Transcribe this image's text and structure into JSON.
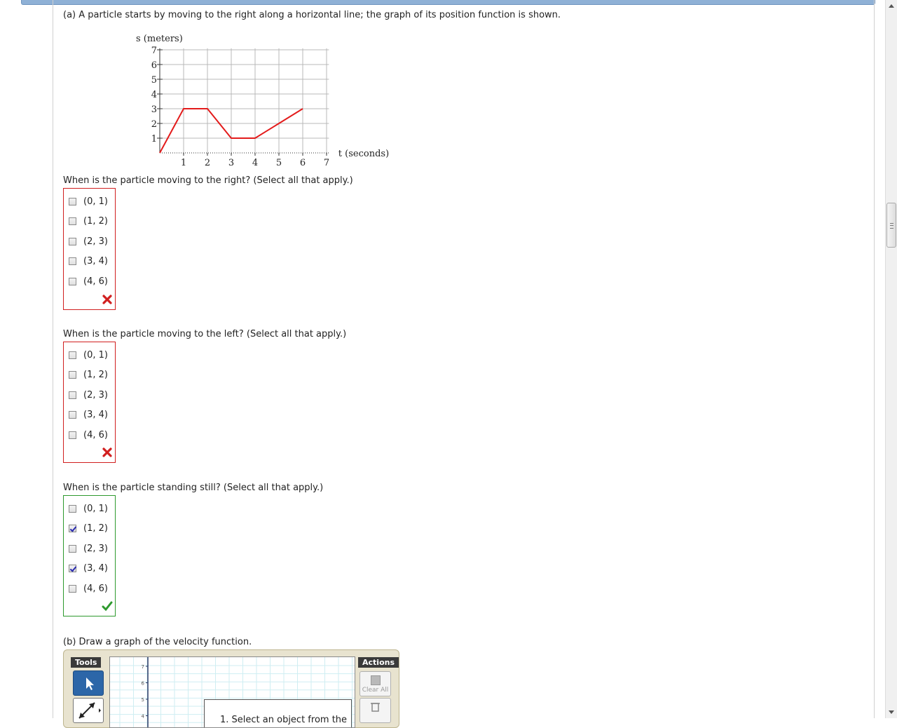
{
  "part_a": {
    "prompt": "(a) A particle starts by moving to the right along a horizontal line; the graph of its position function is shown."
  },
  "chart_data": {
    "type": "line",
    "ylabel": "s (meters)",
    "xlabel": "t (seconds)",
    "x_ticks": [
      "1",
      "2",
      "3",
      "4",
      "5",
      "6",
      "7"
    ],
    "y_ticks": [
      "1",
      "2",
      "3",
      "4",
      "5",
      "6",
      "7"
    ],
    "xlim": [
      0,
      7
    ],
    "ylim": [
      0,
      7
    ],
    "grid": true,
    "series": [
      {
        "color": "#e31b1b",
        "x": [
          0,
          1,
          2,
          3,
          4,
          5,
          6
        ],
        "y": [
          0,
          3,
          3,
          1,
          1,
          2,
          3
        ]
      }
    ]
  },
  "questions": [
    {
      "prompt": "When is the particle moving to the right? (Select all that apply.)",
      "status": "incorrect",
      "options": [
        {
          "label": "(0, 1)",
          "checked": false
        },
        {
          "label": "(1, 2)",
          "checked": false
        },
        {
          "label": "(2, 3)",
          "checked": false
        },
        {
          "label": "(3, 4)",
          "checked": false
        },
        {
          "label": "(4, 6)",
          "checked": false
        }
      ]
    },
    {
      "prompt": "When is the particle moving to the left? (Select all that apply.)",
      "status": "incorrect",
      "options": [
        {
          "label": "(0, 1)",
          "checked": false
        },
        {
          "label": "(1, 2)",
          "checked": false
        },
        {
          "label": "(2, 3)",
          "checked": false
        },
        {
          "label": "(3, 4)",
          "checked": false
        },
        {
          "label": "(4, 6)",
          "checked": false
        }
      ]
    },
    {
      "prompt": "When is the particle standing still? (Select all that apply.)",
      "status": "correct",
      "options": [
        {
          "label": "(0, 1)",
          "checked": false
        },
        {
          "label": "(1, 2)",
          "checked": true
        },
        {
          "label": "(2, 3)",
          "checked": false
        },
        {
          "label": "(3, 4)",
          "checked": true
        },
        {
          "label": "(4, 6)",
          "checked": false
        }
      ]
    }
  ],
  "part_b": {
    "prompt": "(b) Draw a graph of the velocity function.",
    "tools_label": "Tools",
    "actions_label": "Actions",
    "clear_all_label": "Clear All",
    "axis_ticks": [
      "7",
      "6",
      "5",
      "4"
    ],
    "tooltip_text": "1. Select an object from the"
  },
  "colors": {
    "incorrect": "#d11f1f",
    "correct": "#2e9a2e",
    "series": "#e31b1b",
    "tool_active": "#2c66a8"
  }
}
